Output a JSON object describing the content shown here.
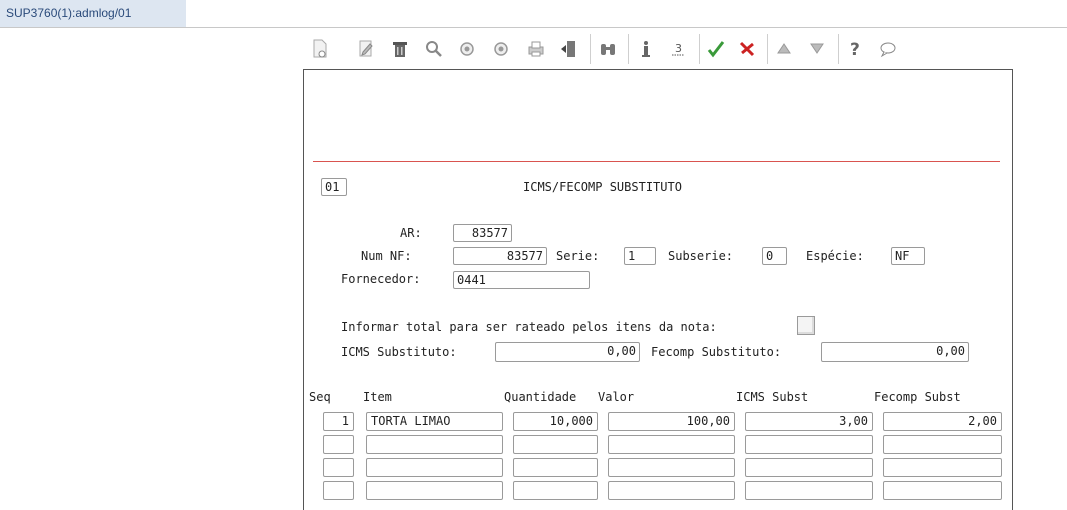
{
  "window": {
    "tab_title": "SUP3760(1):admlog/01"
  },
  "toolbar": {
    "icons": [
      "new-doc-icon",
      "edit-icon",
      "delete-icon",
      "search-icon",
      "prev-icon",
      "next-icon",
      "print-icon",
      "exit-icon",
      "binoculars-icon",
      "info-icon",
      "numbered-list-icon",
      "confirm-icon",
      "cancel-icon",
      "up-icon",
      "down-icon",
      "help-icon",
      "comment-icon"
    ],
    "colors": {
      "confirm": "#3a9a3a",
      "cancel": "#cc2222",
      "icon": "#8a8a8a"
    }
  },
  "form": {
    "page_number": "01",
    "title": "ICMS/FECOMP SUBSTITUTO",
    "ar_label": "AR:",
    "ar_value": "83577",
    "num_nf_label": "Num NF:",
    "num_nf_value": "83577",
    "serie_label": "Serie:",
    "serie_value": "1",
    "subserie_label": "Subserie:",
    "subserie_value": "0",
    "especie_label": "Espécie:",
    "especie_value": "NF",
    "fornecedor_label": "Fornecedor:",
    "fornecedor_value": "0441",
    "informar_label": "Informar total para ser rateado pelos itens da nota:",
    "icms_subst_label": "ICMS Substituto:",
    "icms_subst_value": "0,00",
    "fecomp_subst_label": "Fecomp Substituto:",
    "fecomp_subst_value": "0,00"
  },
  "table": {
    "headers": {
      "seq": "Seq",
      "item": "Item",
      "quantidade": "Quantidade",
      "valor": "Valor",
      "icms": "ICMS Subst",
      "fecomp": "Fecomp Subst"
    },
    "rows": [
      {
        "seq": "1",
        "item": "TORTA LIMAO",
        "quantidade": "10,000",
        "valor": "100,00",
        "icms": "3,00",
        "fecomp": "2,00"
      },
      {
        "seq": "",
        "item": "",
        "quantidade": "",
        "valor": "",
        "icms": "",
        "fecomp": ""
      },
      {
        "seq": "",
        "item": "",
        "quantidade": "",
        "valor": "",
        "icms": "",
        "fecomp": ""
      },
      {
        "seq": "",
        "item": "",
        "quantidade": "",
        "valor": "",
        "icms": "",
        "fecomp": ""
      }
    ]
  }
}
